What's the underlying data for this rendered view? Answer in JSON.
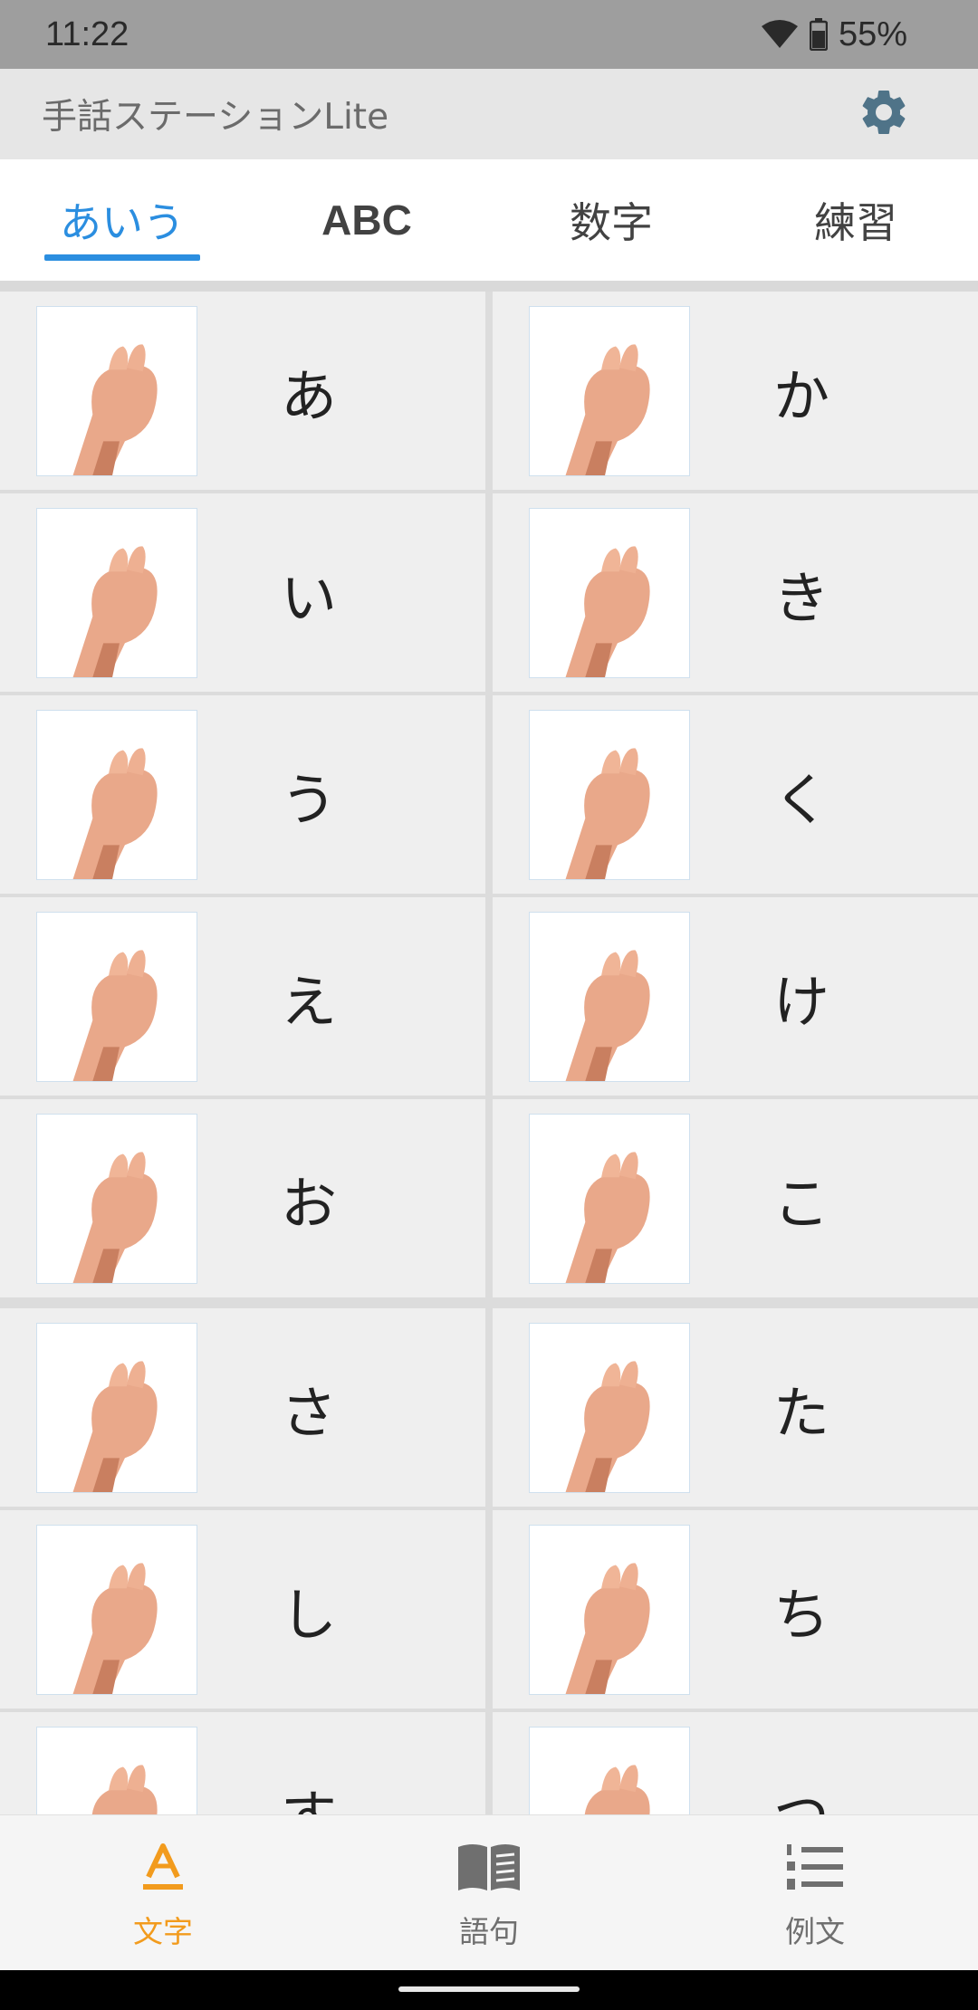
{
  "status_bar": {
    "time": "11:22",
    "battery": "55%"
  },
  "app_bar": {
    "title": "手話ステーションLite"
  },
  "tabs": [
    {
      "label": "あいう",
      "active": true
    },
    {
      "label": "ABC",
      "active": false
    },
    {
      "label": "数字",
      "active": false
    },
    {
      "label": "練習",
      "active": false
    }
  ],
  "groups": [
    {
      "cells": [
        "あ",
        "か",
        "い",
        "き",
        "う",
        "く",
        "え",
        "け",
        "お",
        "こ"
      ]
    },
    {
      "cells": [
        "さ",
        "た",
        "し",
        "ち",
        "す",
        "つ"
      ]
    }
  ],
  "bottom_nav": [
    {
      "label": "文字",
      "icon": "letter-a-icon",
      "active": true
    },
    {
      "label": "語句",
      "icon": "book-icon",
      "active": false
    },
    {
      "label": "例文",
      "icon": "numbered-list-icon",
      "active": false
    }
  ],
  "colors": {
    "accent_tab": "#2b8ee0",
    "accent_nav": "#f29b1d"
  }
}
